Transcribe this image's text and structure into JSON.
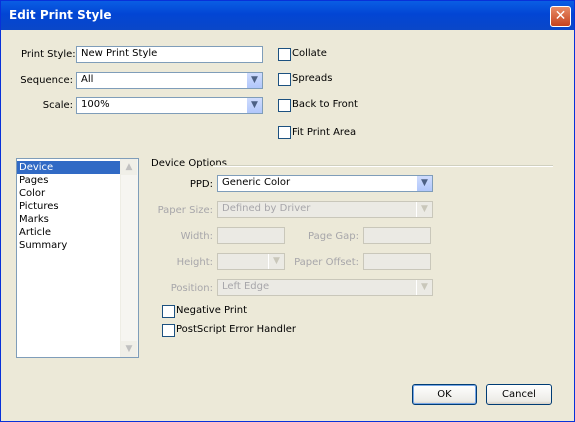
{
  "window": {
    "title": "Edit Print Style",
    "close_glyph": "✕"
  },
  "top": {
    "print_style_label": "Print Style:",
    "print_style_value": "New Print Style",
    "sequence_label": "Sequence:",
    "sequence_value": "All",
    "scale_label": "Scale:",
    "scale_value": "100%",
    "checkboxes": {
      "collate": {
        "label": "Collate",
        "checked": false
      },
      "spreads": {
        "label": "Spreads",
        "checked": false
      },
      "back_to_front": {
        "label": "Back to Front",
        "checked": false
      },
      "fit_print_area": {
        "label": "Fit Print Area",
        "checked": false
      }
    }
  },
  "sidebar": {
    "items": [
      {
        "label": "Device",
        "selected": true
      },
      {
        "label": "Pages"
      },
      {
        "label": "Color"
      },
      {
        "label": "Pictures"
      },
      {
        "label": "Marks"
      },
      {
        "label": "Article"
      },
      {
        "label": "Summary"
      }
    ]
  },
  "device_options": {
    "group_label": "Device Options",
    "ppd_label": "PPD:",
    "ppd_value": "Generic Color",
    "paper_size_label": "Paper Size:",
    "paper_size_value": "Defined by Driver",
    "width_label": "Width:",
    "width_value": "",
    "page_gap_label": "Page Gap:",
    "page_gap_value": "",
    "height_label": "Height:",
    "height_value": "",
    "paper_offset_label": "Paper Offset:",
    "paper_offset_value": "",
    "position_label": "Position:",
    "position_value": "Left Edge",
    "negative_print": {
      "label": "Negative Print",
      "checked": false
    },
    "postscript_error_handler": {
      "label": "PostScript Error Handler",
      "checked": false
    }
  },
  "buttons": {
    "ok": "OK",
    "cancel": "Cancel"
  },
  "icons": {
    "dropdown": "chevron-down-icon",
    "scroll_up": "chevron-up-icon",
    "scroll_down": "chevron-down-icon",
    "close": "close-icon"
  },
  "colors": {
    "titlebar": "#0245d4",
    "selection": "#316ac5",
    "dialog_bg": "#ece9d8"
  }
}
